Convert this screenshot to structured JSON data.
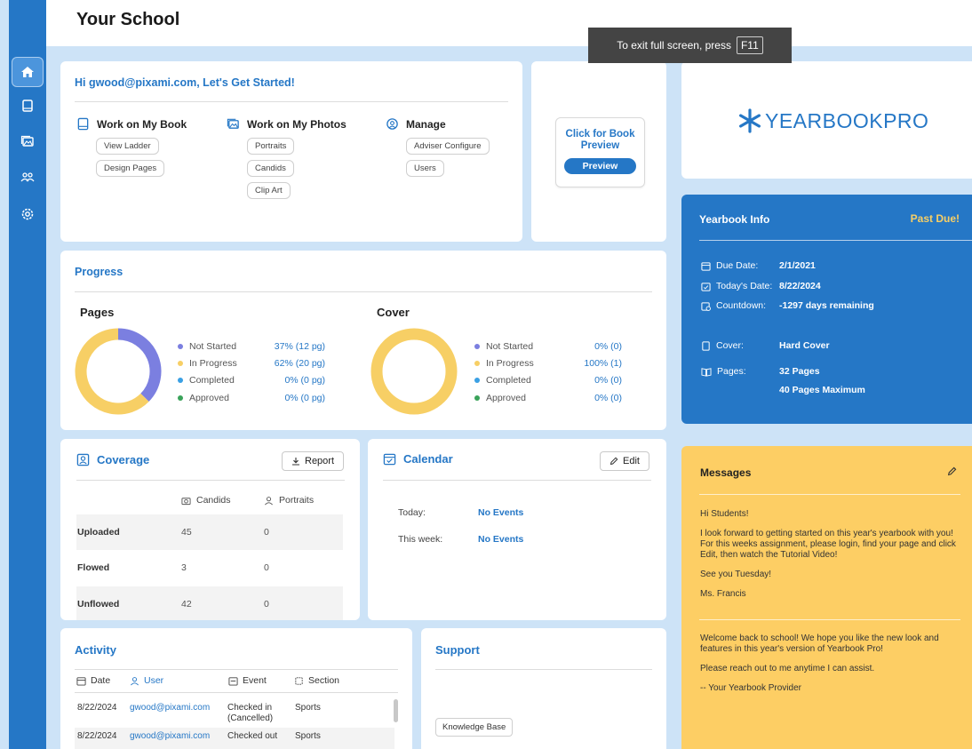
{
  "page": {
    "title": "Your School"
  },
  "toast": {
    "text": "To exit full screen, press",
    "key": "F11"
  },
  "sidebar": {
    "items": [
      "home-icon",
      "book-icon",
      "photos-icon",
      "users-icon",
      "settings-icon"
    ]
  },
  "getstarted": {
    "title": "Hi gwood@pixami.com, Let's Get Started!",
    "book": {
      "label": "Work on My Book",
      "links": [
        "View Ladder",
        "Design Pages"
      ]
    },
    "photos": {
      "label": "Work on My Photos",
      "links": [
        "Portraits",
        "Candids",
        "Clip Art"
      ]
    },
    "manage": {
      "label": "Manage",
      "links": [
        "Adviser Configure",
        "Users"
      ]
    }
  },
  "preview": {
    "label": "Click for Book Preview",
    "button": "Preview"
  },
  "logo": {
    "text": "YEARBOOKPRO"
  },
  "progress": {
    "title": "Progress",
    "pages": {
      "title": "Pages",
      "legend": [
        {
          "label": "Not Started",
          "value": "37% (12 pg)",
          "color": "#7b7fe0"
        },
        {
          "label": "In Progress",
          "value": "62% (20 pg)",
          "color": "#f7cf65"
        },
        {
          "label": "Completed",
          "value": "0% (0 pg)",
          "color": "#3aa0e4"
        },
        {
          "label": "Approved",
          "value": "0% (0 pg)",
          "color": "#3aa35a"
        }
      ]
    },
    "cover": {
      "title": "Cover",
      "legend": [
        {
          "label": "Not Started",
          "value": "0% (0)",
          "color": "#7b7fe0"
        },
        {
          "label": "In Progress",
          "value": "100% (1)",
          "color": "#f7cf65"
        },
        {
          "label": "Completed",
          "value": "0% (0)",
          "color": "#3aa0e4"
        },
        {
          "label": "Approved",
          "value": "0% (0)",
          "color": "#3aa35a"
        }
      ]
    }
  },
  "chart_data": [
    {
      "type": "pie",
      "title": "Pages",
      "categories": [
        "Not Started",
        "In Progress",
        "Completed",
        "Approved"
      ],
      "values": [
        37,
        62,
        0,
        0
      ]
    },
    {
      "type": "pie",
      "title": "Cover",
      "categories": [
        "Not Started",
        "In Progress",
        "Completed",
        "Approved"
      ],
      "values": [
        0,
        100,
        0,
        0
      ]
    }
  ],
  "info": {
    "title": "Yearbook Info",
    "status": "Past Due!",
    "due_label": "Due Date:",
    "due": "2/1/2021",
    "today_label": "Today's Date:",
    "today": "8/22/2024",
    "countdown_label": "Countdown:",
    "countdown": "-1297 days remaining",
    "cover_label": "Cover:",
    "cover": "Hard Cover",
    "pages_label": "Pages:",
    "pages": "32 Pages",
    "max": "40 Pages Maximum"
  },
  "coverage": {
    "title": "Coverage",
    "report_button": "Report",
    "columns": [
      "Candids",
      "Portraits"
    ],
    "rows": [
      {
        "label": "Uploaded",
        "candids": "45",
        "portraits": "0"
      },
      {
        "label": "Flowed",
        "candids": "3",
        "portraits": "0"
      },
      {
        "label": "Unflowed",
        "candids": "42",
        "portraits": "0"
      }
    ]
  },
  "calendar": {
    "title": "Calendar",
    "edit_button": "Edit",
    "today_label": "Today:",
    "today_value": "No Events",
    "week_label": "This week:",
    "week_value": "No Events"
  },
  "messages": {
    "title": "Messages",
    "m1": [
      "Hi Students!",
      "I look forward to getting started on this year's yearbook with you! For this weeks assignment, please login, find your page and click Edit, then watch the Tutorial Video!",
      "See you Tuesday!",
      "Ms. Francis"
    ],
    "m2": [
      "Welcome back to school! We hope you like the new look and features in this year's version of Yearbook Pro!",
      "Please reach out to me anytime I can assist.",
      "-- Your Yearbook Provider"
    ]
  },
  "activity": {
    "title": "Activity",
    "columns": [
      "Date",
      "User",
      "Event",
      "Section"
    ],
    "rows": [
      {
        "date": "8/22/2024",
        "user": "gwood@pixami.com",
        "event": "Checked in (Cancelled)",
        "section": "Sports"
      },
      {
        "date": "8/22/2024",
        "user": "gwood@pixami.com",
        "event": "Checked out",
        "section": "Sports"
      }
    ]
  },
  "support": {
    "title": "Support",
    "kb_button": "Knowledge Base"
  }
}
